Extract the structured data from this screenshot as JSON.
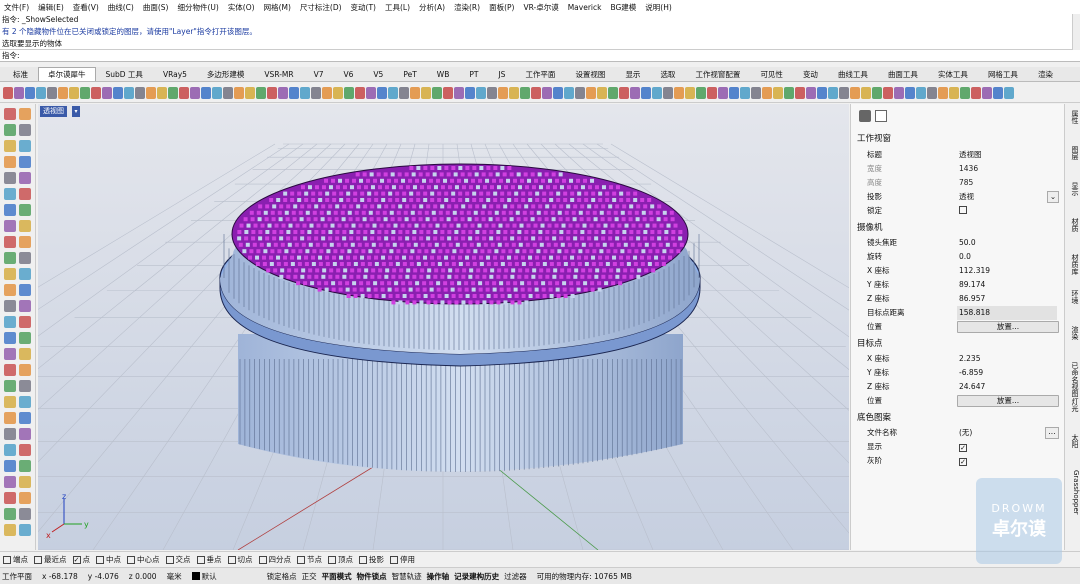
{
  "menu": [
    "文件(F)",
    "编辑(E)",
    "查看(V)",
    "曲线(C)",
    "曲面(S)",
    "细分物件(U)",
    "实体(O)",
    "网格(M)",
    "尺寸标注(D)",
    "变动(T)",
    "工具(L)",
    "分析(A)",
    "渲染(R)",
    "面板(P)",
    "VR-卓尔谟",
    "Maverick",
    "BG建模",
    "说明(H)"
  ],
  "command": {
    "history": [
      "指令: _ShowSelected",
      "有 2 个隐藏物件位在已关闭或锁定的图层，请使用\"Layer\"指令打开该图层。",
      "选取要显示的物体"
    ],
    "prompt": "指令:"
  },
  "tabs": [
    "标准",
    "卓尔谟犀牛",
    "SubD 工具",
    "VRay5",
    "多边形建模",
    "VSR-MR",
    "V7",
    "V6",
    "V5",
    "PeT",
    "WB",
    "PT",
    "JS",
    "工作平面",
    "设置视图",
    "显示",
    "选取",
    "工作视窗配置",
    "可见性",
    "变动",
    "曲线工具",
    "曲面工具",
    "实体工具",
    "网格工具",
    "渲染"
  ],
  "active_tab": "卓尔谟犀牛",
  "viewport": {
    "label": "透视图",
    "axis_x": "x",
    "axis_y": "y",
    "axis_z": "z"
  },
  "panel": {
    "section_viewport": "工作视窗",
    "title_label": "标题",
    "title_value": "透视图",
    "width_label": "宽度",
    "width_value": "1436",
    "height_label": "高度",
    "height_value": "785",
    "projection_label": "投影",
    "projection_value": "透视",
    "locked_label": "锁定",
    "section_camera": "摄像机",
    "focal_label": "镜头焦距",
    "focal_value": "50.0",
    "rotation_label": "旋转",
    "rotation_value": "0.0",
    "cam_x_label": "X 座标",
    "cam_x_value": "112.319",
    "cam_y_label": "Y 座标",
    "cam_y_value": "89.174",
    "cam_z_label": "Z 座标",
    "cam_z_value": "86.957",
    "target_dist_label": "目标点距离",
    "target_dist_value": "158.818",
    "position_label": "位置",
    "place_button": "放置...",
    "section_target": "目标点",
    "tgt_x_label": "X 座标",
    "tgt_x_value": "2.235",
    "tgt_y_label": "Y 座标",
    "tgt_y_value": "-6.859",
    "tgt_z_label": "Z 座标",
    "tgt_z_value": "24.647",
    "tgt_position_label": "位置",
    "tgt_place_button": "放置...",
    "section_bg": "底色图案",
    "filename_label": "文件名称",
    "filename_value": "(无)",
    "browse_button": "...",
    "show_label": "显示",
    "gray_label": "灰阶"
  },
  "side_tabs": [
    "属性",
    "图层",
    "显示",
    "材质",
    "材质库",
    "环境",
    "渲染",
    "已命名视图",
    "灯光",
    "太阳",
    "Grasshopper"
  ],
  "osnap": [
    {
      "label": "端点",
      "checked": false
    },
    {
      "label": "最近点",
      "checked": false
    },
    {
      "label": "点",
      "checked": true
    },
    {
      "label": "中点",
      "checked": false
    },
    {
      "label": "中心点",
      "checked": false
    },
    {
      "label": "交点",
      "checked": false
    },
    {
      "label": "垂点",
      "checked": false
    },
    {
      "label": "切点",
      "checked": false
    },
    {
      "label": "四分点",
      "checked": false
    },
    {
      "label": "节点",
      "checked": false
    },
    {
      "label": "顶点",
      "checked": false
    },
    {
      "label": "投影",
      "checked": false
    },
    {
      "label": "停用",
      "checked": false
    }
  ],
  "status": {
    "plane": "工作平面",
    "x": "x -68.178",
    "y": "y -4.076",
    "z": "z 0.000",
    "unit": "毫米",
    "layer": "默认",
    "items": [
      "锁定格点",
      "正交",
      "平面模式",
      "物件锁点",
      "智慧轨迹",
      "操作轴",
      "记录建构历史",
      "过滤器"
    ],
    "bold_items": [
      "平面模式",
      "物件锁点",
      "操作轴",
      "记录建构历史"
    ],
    "memory": "可用的物理内存: 10765 MB"
  },
  "watermark": {
    "en": "DROWM",
    "cn": "卓尔谟"
  },
  "colors": {
    "viewport_bg": "#dcdfe6",
    "fin": "#b6c6e0",
    "fin_top": "#a020c0",
    "ring": "#8fb0e8",
    "accent": "#3a5aa8"
  }
}
